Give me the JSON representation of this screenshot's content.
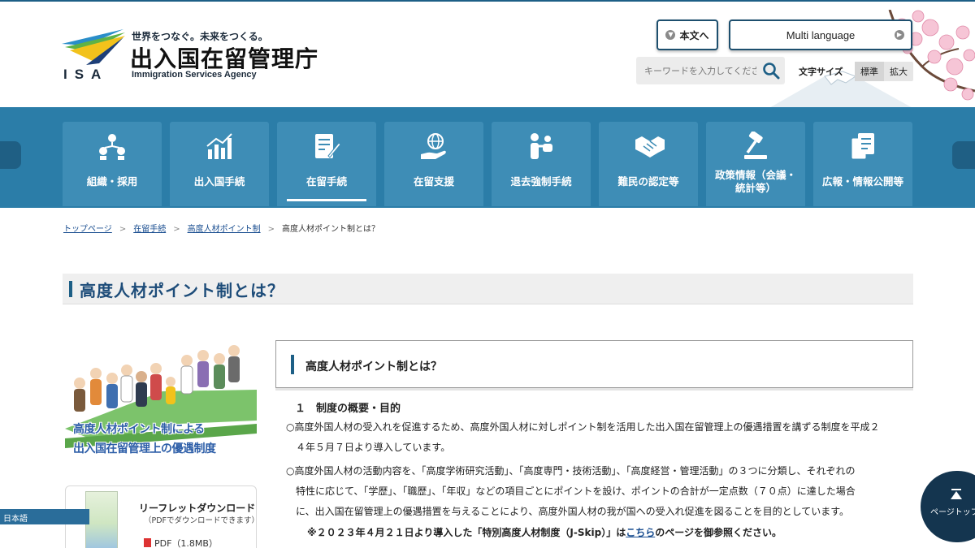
{
  "site": {
    "tagline": "世界をつなぐ。未来をつくる。",
    "name_ja": "出入国在留管理庁",
    "name_en": "Immigration Services Agency",
    "abbr": "ISA"
  },
  "header": {
    "skip_label": "本文へ",
    "lang_label": "Multi language",
    "search_placeholder": "キーワードを入力してください",
    "fontsize_label": "文字サイズ",
    "fontsize_standard": "標準",
    "fontsize_large": "拡大"
  },
  "nav": {
    "items": [
      {
        "label": "組織・採用",
        "icon": "organization-icon"
      },
      {
        "label": "出入国手続",
        "icon": "chart-icon"
      },
      {
        "label": "在留手続",
        "icon": "document-pen-icon",
        "active": true
      },
      {
        "label": "在留支援",
        "icon": "globe-hand-icon"
      },
      {
        "label": "退去強制手続",
        "icon": "people-icon"
      },
      {
        "label": "難民の認定等",
        "icon": "handshake-icon"
      },
      {
        "label": "政策情報（会議・統計等）",
        "icon": "gavel-icon"
      },
      {
        "label": "広報・情報公開等",
        "icon": "documents-icon"
      }
    ]
  },
  "breadcrumb": {
    "items": [
      "トップページ",
      "在留手続",
      "高度人材ポイント制",
      "高度人材ポイント制とは？"
    ]
  },
  "page_title": "高度人材ポイント制とは？",
  "sidebar": {
    "promo_line1": "高度人材ポイント制による",
    "promo_line2": "出入国在留管理上の優遇制度",
    "leaflet_title": "リーフレットダウンロード",
    "leaflet_sub": "（PDFでダウンロードできます）",
    "leaflet_pdf": "PDF（1.8MB）"
  },
  "main": {
    "section_title": "高度人材ポイント制とは？",
    "subhead": "１　制度の概要・目的",
    "para1_line1": "○高度外国人材の受入れを促進するため、高度外国人材に対しポイント制を活用した出入国在留管理上の優遇措置を講ずる制度を平成２",
    "para1_line2": "　４年５月７日より導入しています。",
    "para2_line1": "○高度外国人材の活動内容を、「高度学術研究活動」、「高度専門・技術活動」、「高度経営・管理活動」の３つに分類し、それぞれの",
    "para2_line2": "　特性に応じて、「学歴」、「職歴」、「年収」などの項目ごとにポイントを設け、ポイントの合計が一定点数（７０点）に達した場合",
    "para2_line3": "　に、出入国在留管理上の優遇措置を与えることにより、高度外国人材の我が国への受入れ促進を図ることを目的としています。",
    "note_prefix": "※２０２３年４月２１日より導入した「特別高度人材制度（J-Skip）」は",
    "note_link": "こちら",
    "note_suffix": "のページを御参照ください。"
  },
  "language_tab": "日本語",
  "pagetop_label": "ページトップ",
  "colors": {
    "nav_band": "#2b7da8",
    "nav_tile": "#3e8db6",
    "title_text": "#1d4c79",
    "link": "#1a4e90",
    "pagetop_bg": "#14354f"
  }
}
